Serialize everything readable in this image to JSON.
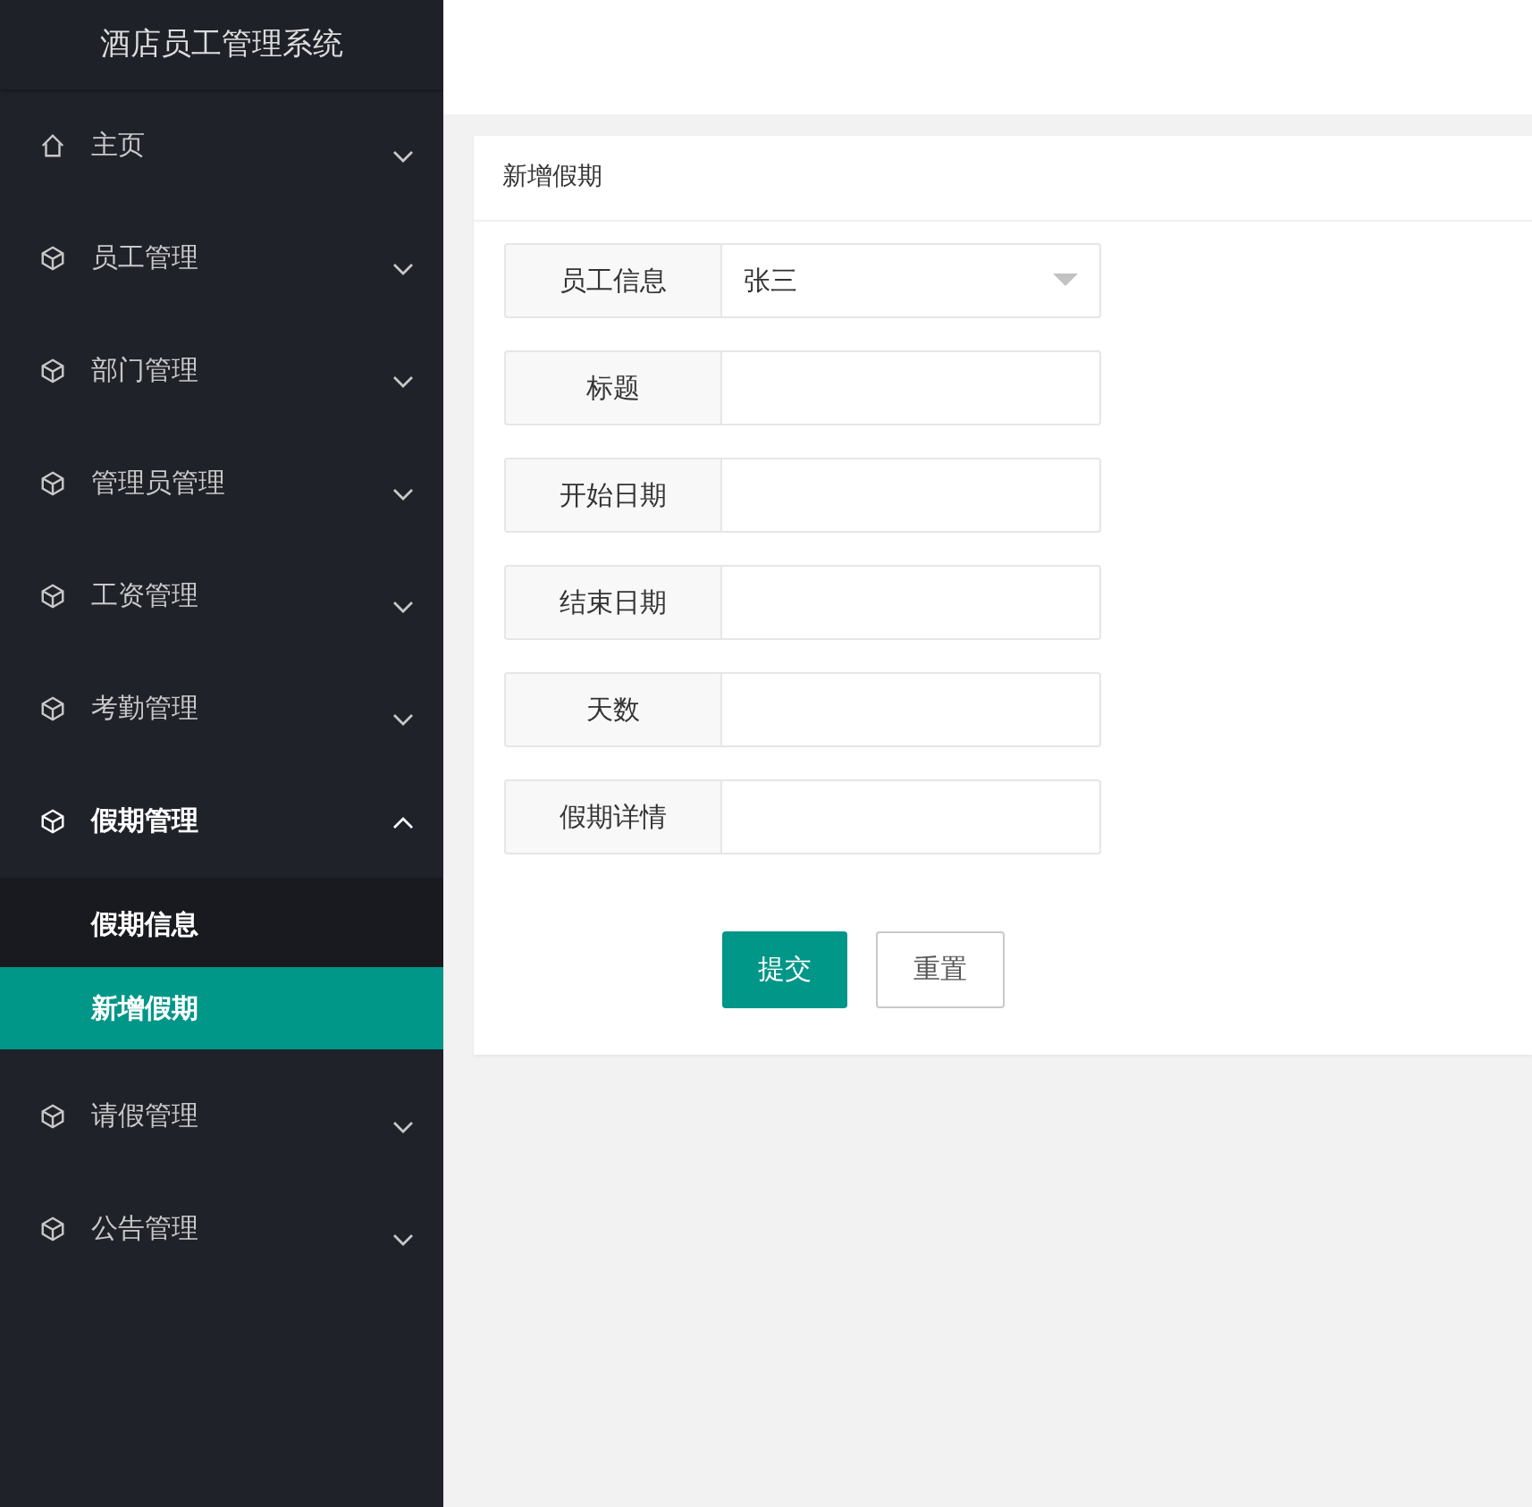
{
  "sidebar": {
    "title": "酒店员工管理系统",
    "items": [
      {
        "label": "主页",
        "kind": "home",
        "expanded": false
      },
      {
        "label": "员工管理",
        "kind": "module",
        "expanded": false
      },
      {
        "label": "部门管理",
        "kind": "module",
        "expanded": false
      },
      {
        "label": "管理员管理",
        "kind": "module",
        "expanded": false
      },
      {
        "label": "工资管理",
        "kind": "module",
        "expanded": false
      },
      {
        "label": "考勤管理",
        "kind": "module",
        "expanded": false
      },
      {
        "label": "假期管理",
        "kind": "module",
        "expanded": true,
        "children": [
          {
            "label": "假期信息",
            "selected": false
          },
          {
            "label": "新增假期",
            "selected": true
          }
        ]
      },
      {
        "label": "请假管理",
        "kind": "module",
        "expanded": false
      },
      {
        "label": "公告管理",
        "kind": "module",
        "expanded": false
      }
    ]
  },
  "card": {
    "title": "新增假期",
    "fields": [
      {
        "label": "员工信息",
        "kind": "select",
        "value": "张三"
      },
      {
        "label": "标题",
        "kind": "text"
      },
      {
        "label": "开始日期",
        "kind": "text"
      },
      {
        "label": "结束日期",
        "kind": "text"
      },
      {
        "label": "天数",
        "kind": "text"
      },
      {
        "label": "假期详情",
        "kind": "text"
      }
    ],
    "buttons": [
      {
        "label": "提交",
        "kind": "primary"
      },
      {
        "label": "重置",
        "kind": "default"
      }
    ]
  }
}
